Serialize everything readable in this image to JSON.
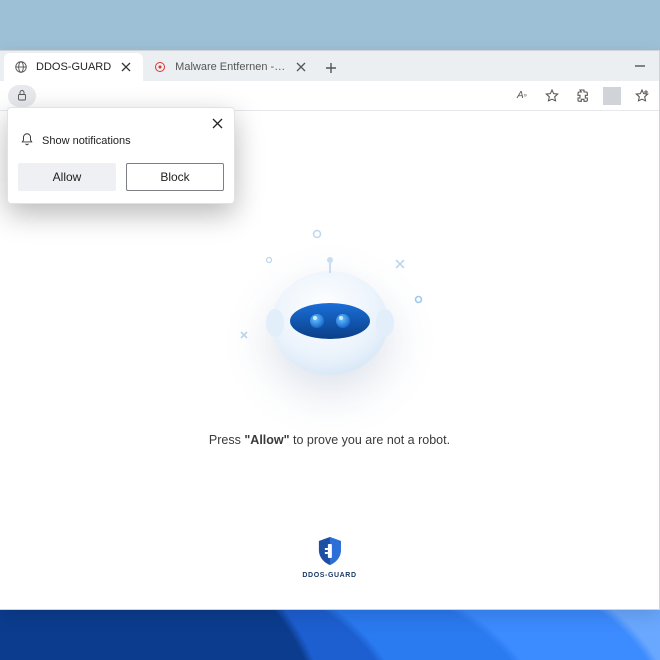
{
  "browser": {
    "tabs": [
      {
        "title": "DDOS-GUARD",
        "favicon": "globe",
        "active": true
      },
      {
        "title": "Malware Entfernen - Kostenlose A",
        "favicon": "target",
        "active": false
      }
    ],
    "minimize_tip": "Minimize",
    "url_value": "",
    "toolbar": {
      "read_aloud_tip": "Read aloud",
      "favorite_tip": "Add to favorites",
      "extensions_tip": "Extensions",
      "collections_tip": "Collections"
    }
  },
  "notification": {
    "title": "Show notifications",
    "allow_label": "Allow",
    "block_label": "Block"
  },
  "page": {
    "caption_pre": "Press ",
    "caption_bold": "\"Allow\"",
    "caption_post": " to prove you are not a robot.",
    "footer_brand": "DDOS-GUARD"
  }
}
